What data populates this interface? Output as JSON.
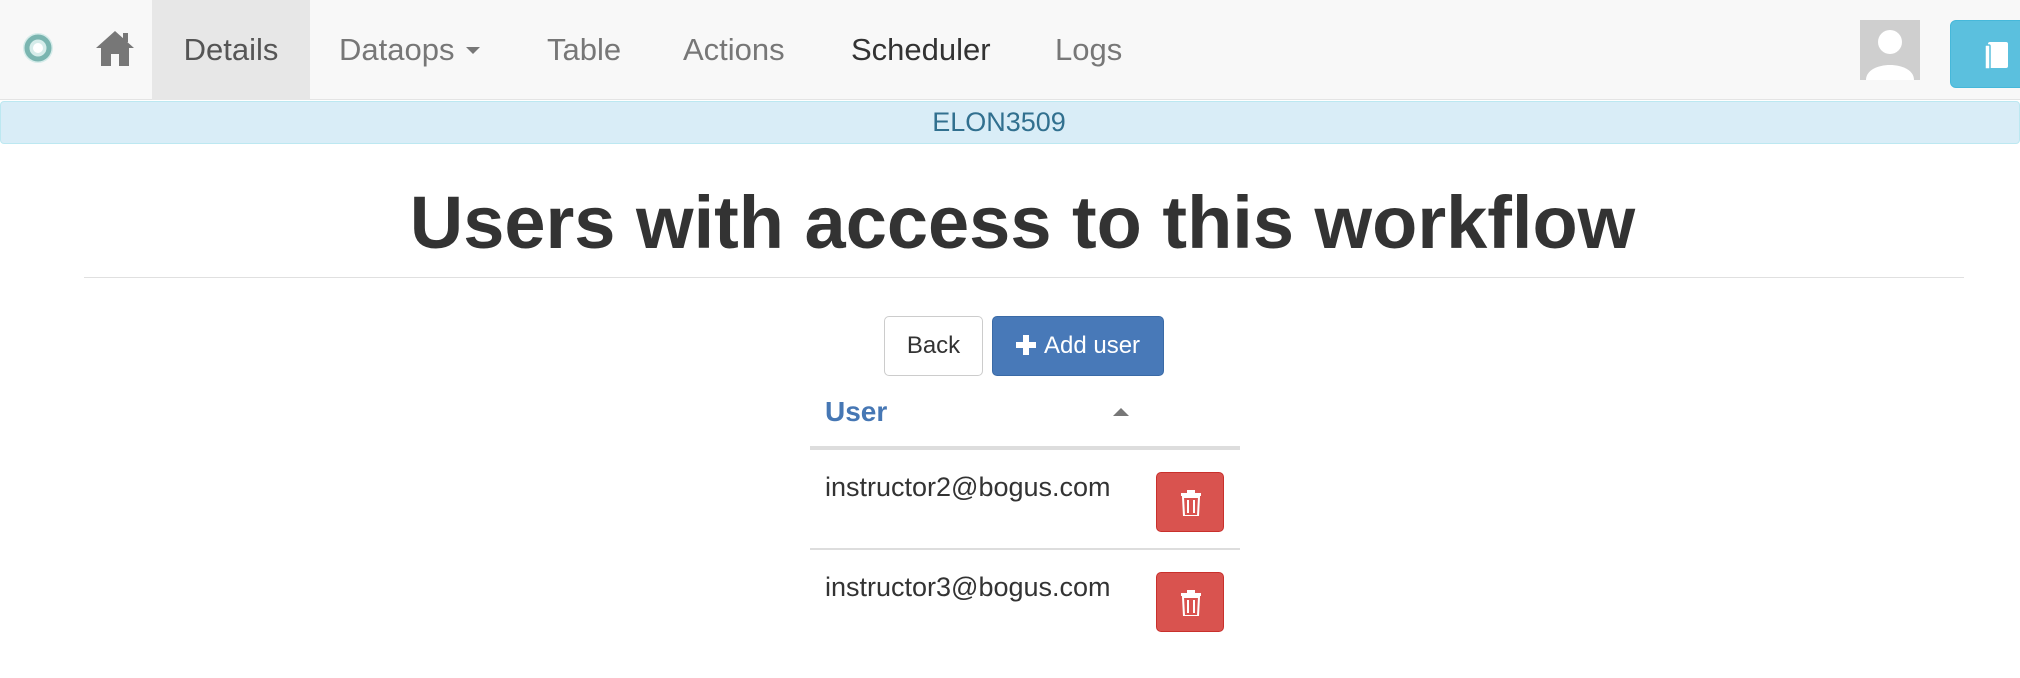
{
  "nav": {
    "brand_icon": "ontask-logo-icon",
    "home_icon": "home-icon",
    "items": [
      {
        "label": "Details",
        "active": true
      },
      {
        "label": "Dataops",
        "has_dropdown": true
      },
      {
        "label": "Table"
      },
      {
        "label": "Actions"
      },
      {
        "label": "Scheduler"
      },
      {
        "label": "Logs"
      }
    ],
    "avatar_icon": "user-avatar-icon",
    "help_icon": "book-icon"
  },
  "workflow": {
    "name": "ELON3509"
  },
  "page": {
    "title": "Users with access to this workflow"
  },
  "buttons": {
    "back_label": "Back",
    "add_user_label": "Add user",
    "add_user_icon": "plus-icon"
  },
  "table": {
    "columns": [
      {
        "label": "User",
        "sorted": "ascending"
      }
    ],
    "rows": [
      {
        "email": "instructor2@bogus.com",
        "action_icon": "trash-icon"
      },
      {
        "email": "instructor3@bogus.com",
        "action_icon": "trash-icon"
      }
    ]
  },
  "colors": {
    "primary": "#4879b8",
    "danger": "#d9534f",
    "info_banner": "#d9edf7",
    "info_text": "#31708f",
    "header_link": "#4677b4",
    "help_button": "#5bc0de"
  }
}
